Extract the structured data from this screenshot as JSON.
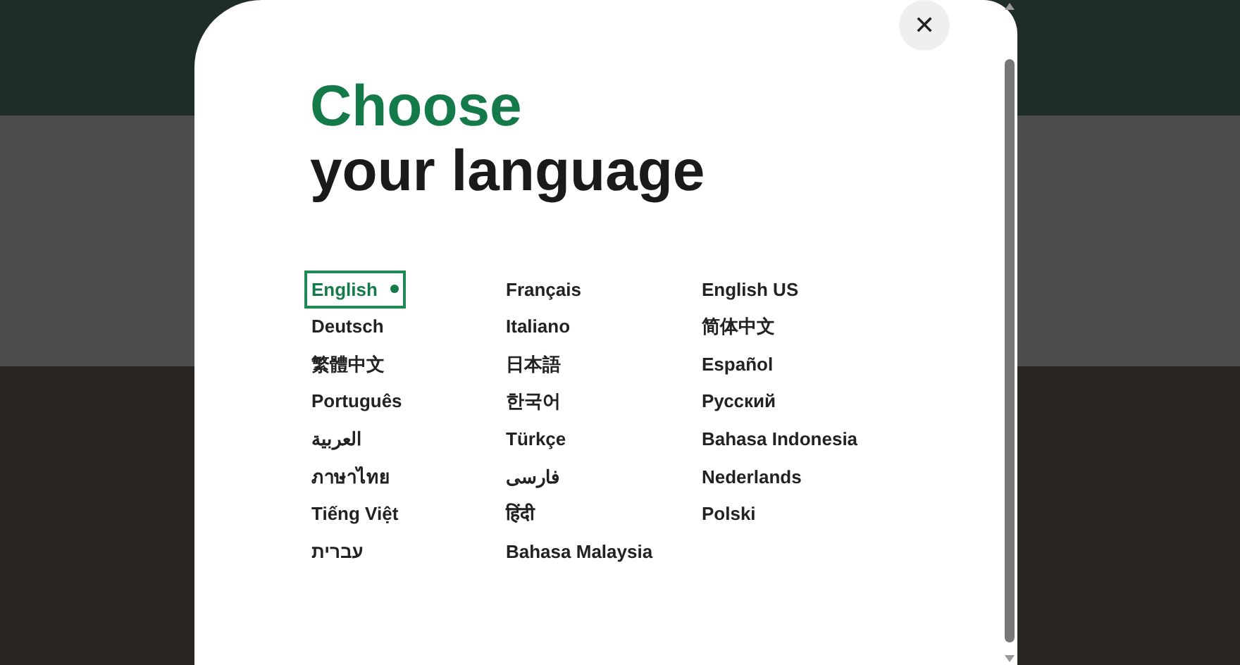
{
  "dialog": {
    "title_accent": "Choose",
    "title": "your language",
    "close_label": "✕"
  },
  "languages": [
    {
      "label": "English",
      "selected": true
    },
    {
      "label": "Deutsch",
      "selected": false
    },
    {
      "label": "繁體中文",
      "selected": false
    },
    {
      "label": "Português",
      "selected": false
    },
    {
      "label": "العربية",
      "selected": false
    },
    {
      "label": "ภาษาไทย",
      "selected": false
    },
    {
      "label": "Tiếng Việt",
      "selected": false
    },
    {
      "label": "עברית",
      "selected": false
    },
    {
      "label": "Français",
      "selected": false
    },
    {
      "label": "Italiano",
      "selected": false
    },
    {
      "label": "日本語",
      "selected": false
    },
    {
      "label": "한국어",
      "selected": false
    },
    {
      "label": "Türkçe",
      "selected": false
    },
    {
      "label": "فارسی",
      "selected": false
    },
    {
      "label": "हिंदी",
      "selected": false
    },
    {
      "label": "Bahasa Malaysia",
      "selected": false
    },
    {
      "label": "English US",
      "selected": false
    },
    {
      "label": "简体中文",
      "selected": false
    },
    {
      "label": "Español",
      "selected": false
    },
    {
      "label": "Русский",
      "selected": false
    },
    {
      "label": "Bahasa Indonesia",
      "selected": false
    },
    {
      "label": "Nederlands",
      "selected": false
    },
    {
      "label": "Polski",
      "selected": false
    }
  ]
}
